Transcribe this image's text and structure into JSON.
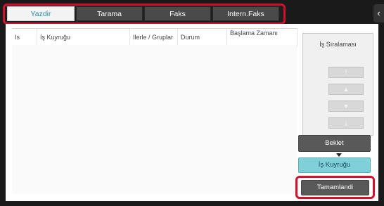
{
  "tabs": [
    {
      "label": "Yazdir",
      "active": true
    },
    {
      "label": "Tarama",
      "active": false
    },
    {
      "label": "Faks",
      "active": false
    },
    {
      "label": "Intern.Faks",
      "active": false
    }
  ],
  "side_handle_glyph": "‹",
  "table": {
    "columns": [
      "Is",
      "İş Kuyruğu",
      "Ilerle / Gruplar",
      "Durum",
      "Başlama Zamanı"
    ],
    "rows": []
  },
  "sort": {
    "label": "İş Sıralaması",
    "buttons": [
      {
        "icon": "move-top-icon",
        "glyph": "⤒"
      },
      {
        "icon": "move-up-icon",
        "glyph": "▲"
      },
      {
        "icon": "move-down-icon",
        "glyph": "▼"
      },
      {
        "icon": "move-bottom-icon",
        "glyph": "⤓"
      }
    ]
  },
  "buttons": {
    "wait_label": "Beklet",
    "queue_label": "İş Kuyruğu",
    "complete_label": "Tamamlandi"
  },
  "colors": {
    "highlight": "#d1122d",
    "active_tab_text": "#2a8f9a",
    "selected_button": "#7fd0d8"
  }
}
